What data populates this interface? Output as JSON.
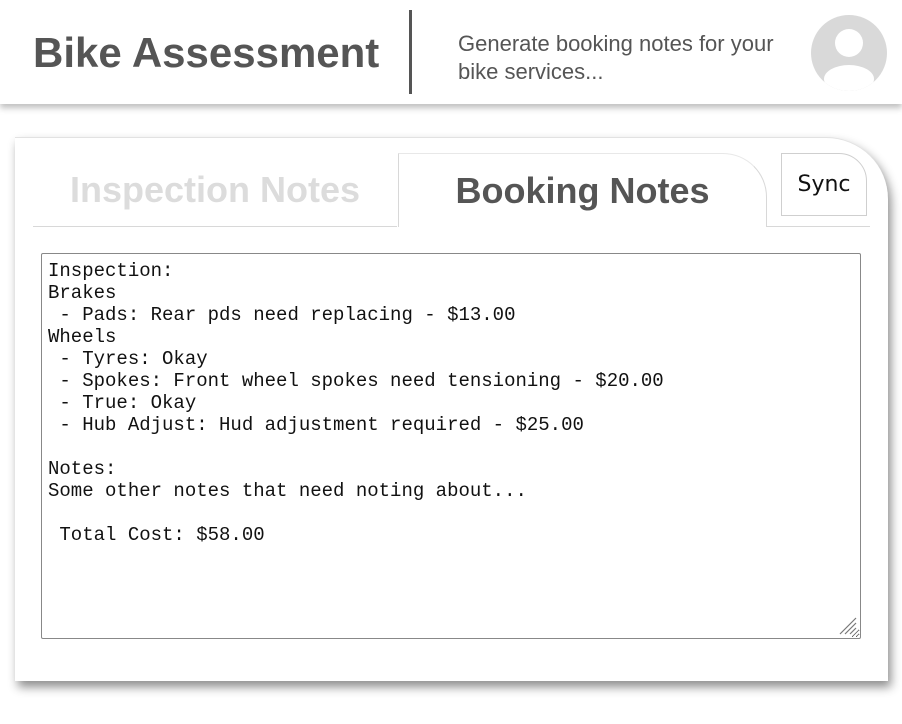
{
  "header": {
    "title": "Bike Assessment",
    "subtitle": "Generate booking notes for your bike services...",
    "avatar_icon": "user-avatar-icon"
  },
  "tabs": [
    {
      "label": "Inspection Notes",
      "active": false
    },
    {
      "label": "Booking Notes",
      "active": true
    }
  ],
  "sync_label": "Sync",
  "notes": {
    "value": "Inspection:\nBrakes\n - Pads: Rear pds need replacing - $13.00\nWheels\n - Tyres: Okay\n - Spokes: Front wheel spokes need tensioning - $20.00\n - True: Okay\n - Hub Adjust: Hud adjustment required - $25.00\n\nNotes:\nSome other notes that need noting about...\n\n Total Cost: $58.00"
  },
  "colors": {
    "text": "#555555",
    "inactive_tab": "#dcdcdc",
    "avatar": "#d9d9d9"
  }
}
